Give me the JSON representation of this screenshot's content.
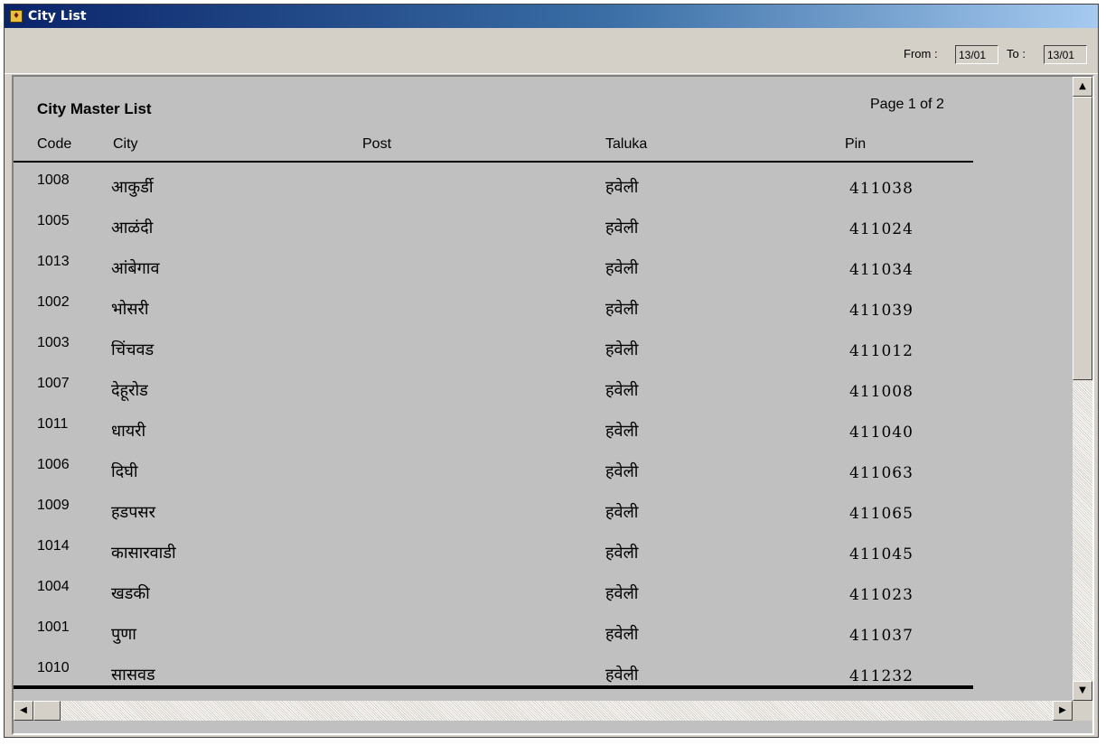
{
  "window": {
    "title": "City List",
    "icon": "app-icon"
  },
  "toolbar": {
    "from_label": "From :",
    "from_value": "13/01",
    "to_label": "To :",
    "to_value": "13/01"
  },
  "report": {
    "title": "City Master List",
    "page_info": "Page 1 of 2",
    "columns": {
      "code": "Code",
      "city": "City",
      "post": "Post",
      "taluka": "Taluka",
      "pin": "Pin"
    },
    "rows": [
      {
        "code": "1008",
        "city": "आकुर्डी",
        "post": "",
        "taluka": "हवेली",
        "pin": "411038"
      },
      {
        "code": "1005",
        "city": "आळंदी",
        "post": "",
        "taluka": "हवेली",
        "pin": "411024"
      },
      {
        "code": "1013",
        "city": "आंबेगाव",
        "post": "",
        "taluka": "हवेली",
        "pin": "411034"
      },
      {
        "code": "1002",
        "city": "भोसरी",
        "post": "",
        "taluka": "हवेली",
        "pin": "411039"
      },
      {
        "code": "1003",
        "city": "चिंचवड",
        "post": "",
        "taluka": "हवेली",
        "pin": "411012"
      },
      {
        "code": "1007",
        "city": "देहूरोड",
        "post": "",
        "taluka": "हवेली",
        "pin": "411008"
      },
      {
        "code": "1011",
        "city": "धायरी",
        "post": "",
        "taluka": "हवेली",
        "pin": "411040"
      },
      {
        "code": "1006",
        "city": "दिघी",
        "post": "",
        "taluka": "हवेली",
        "pin": "411063"
      },
      {
        "code": "1009",
        "city": "हडपसर",
        "post": "",
        "taluka": "हवेली",
        "pin": "411065"
      },
      {
        "code": "1014",
        "city": "कासारवाडी",
        "post": "",
        "taluka": "हवेली",
        "pin": "411045"
      },
      {
        "code": "1004",
        "city": "खडकी",
        "post": "",
        "taluka": "हवेली",
        "pin": "411023"
      },
      {
        "code": "1001",
        "city": "पुणा",
        "post": "",
        "taluka": "हवेली",
        "pin": "411037"
      },
      {
        "code": "1010",
        "city": "सासवड",
        "post": "",
        "taluka": "हवेली",
        "pin": "411232"
      }
    ]
  },
  "colors": {
    "titlebar_start": "#0a246a",
    "titlebar_end": "#a6caf0",
    "face": "#d4d0c8",
    "report_bg": "#c0c0c0"
  },
  "scrollbars": {
    "up_icon": "arrow-up-icon",
    "down_icon": "arrow-down-icon",
    "left_icon": "arrow-left-icon",
    "right_icon": "arrow-right-icon"
  }
}
